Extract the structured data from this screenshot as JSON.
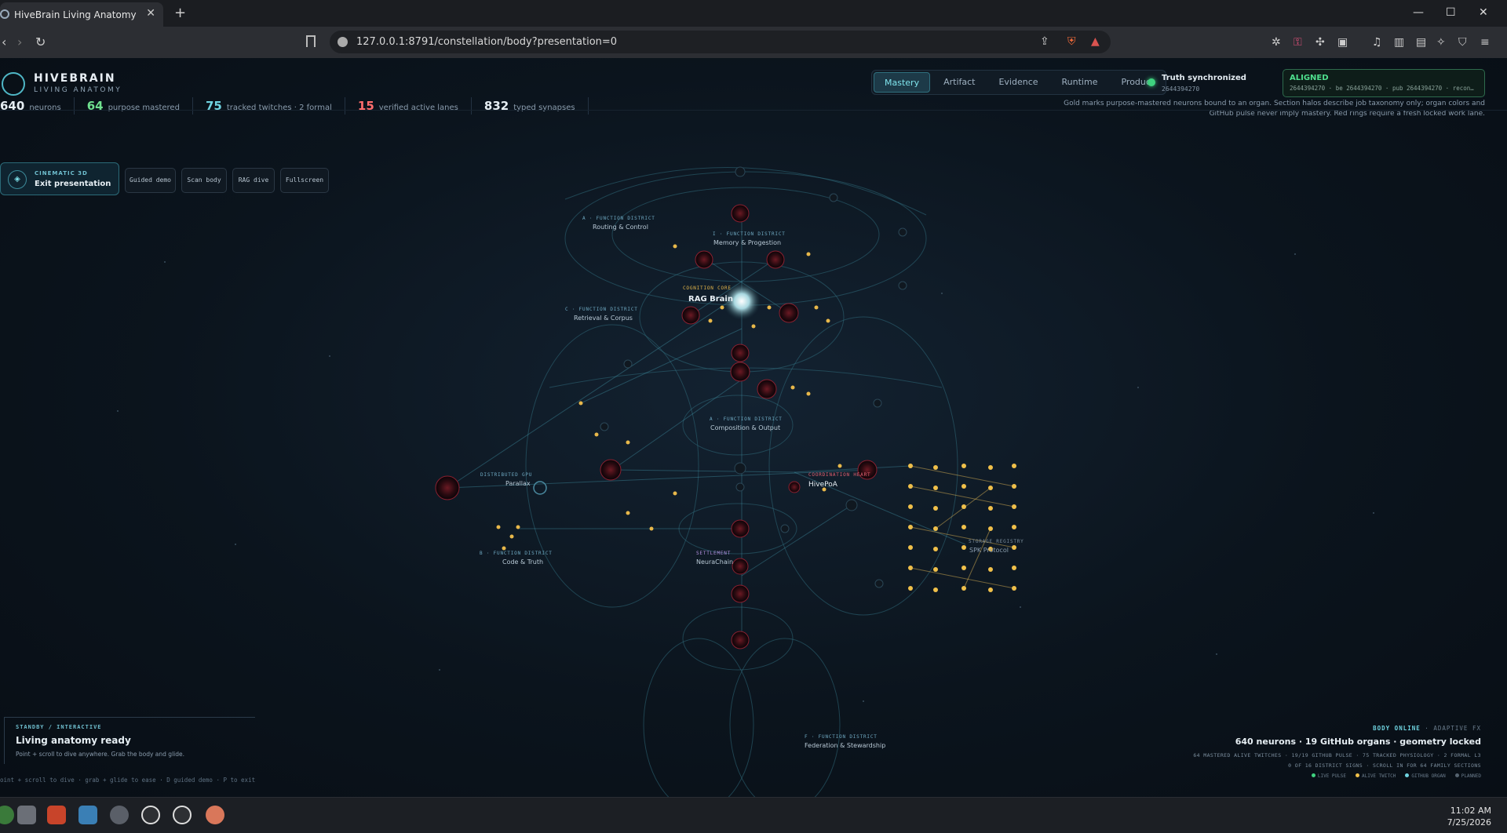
{
  "browser": {
    "tab_title": "HiveBrain Living Anatomy",
    "url": "127.0.0.1:8791/constellation/body?presentation=0"
  },
  "brand": {
    "title": "HIVEBRAIN",
    "subtitle": "LIVING ANATOMY"
  },
  "modes": [
    "Mastery",
    "Artifact",
    "Evidence",
    "Runtime",
    "Product"
  ],
  "truth": {
    "title": "Truth synchronized",
    "hash": "2644394270"
  },
  "aligned": {
    "label": "ALIGNED",
    "detail": "2644394270 · be 2644394270 · pub 2644394270 · recon…"
  },
  "stats": [
    {
      "value": "640",
      "label": "neurons",
      "color": "#e6eef3"
    },
    {
      "value": "64",
      "label": "purpose mastered",
      "color": "#6fe08e"
    },
    {
      "value": "75",
      "label": "tracked twitches · 2 formal",
      "color": "#6fd3e0"
    },
    {
      "value": "15",
      "label": "verified active lanes",
      "color": "#ff6d6d"
    },
    {
      "value": "832",
      "label": "typed synapses",
      "color": "#e6eef3"
    }
  ],
  "note": "Gold marks purpose-mastered neurons bound to an organ. Section halos describe job taxonomy only; organ colors and GitHub pulse never imply mastery. Red rings require a fresh locked work lane.",
  "cinematic": {
    "key": "CINEMATIC 3D",
    "value": "Exit presentation"
  },
  "controls": [
    "Guided demo",
    "Scan body",
    "RAG dive",
    "Fullscreen"
  ],
  "districts": [
    {
      "key": "A · FUNCTION DISTRICT",
      "name": "Routing & Control"
    },
    {
      "key": "I · FUNCTION DISTRICT",
      "name": "Memory & Progestion"
    },
    {
      "key": "COGNITION CORE",
      "name": "RAG Brain"
    },
    {
      "key": "C · FUNCTION DISTRICT",
      "name": "Retrieval & Corpus"
    },
    {
      "key": "A · FUNCTION DISTRICT",
      "name": "Composition & Output"
    },
    {
      "key": "DISTRIBUTED GPU",
      "name": "Parallax"
    },
    {
      "key": "COORDINATION HEART",
      "name": "HivePoA"
    },
    {
      "key": "B · FUNCTION DISTRICT",
      "name": "Code & Truth"
    },
    {
      "key": "SETTLEMENT",
      "name": "NeuraChain"
    },
    {
      "key": "STORAGE REGISTRY",
      "name": "SPK Protocol"
    },
    {
      "key": "F · FUNCTION DISTRICT",
      "name": "Federation & Stewardship"
    }
  ],
  "standby": {
    "key": "STANDBY / INTERACTIVE",
    "title": "Living anatomy ready",
    "sub": "Point + scroll to dive anywhere. Grab the body and glide."
  },
  "hint": "oint + scroll to dive · grab + glide to ease · D guided demo · P to exit",
  "body_online": {
    "key_a": "BODY ONLINE",
    "key_b": " · ADAPTIVE FX",
    "title": "640 neurons · 19 GitHub organs · geometry locked",
    "meta1": "64 MASTERED ALIVE TWITCHES · 19/19 GITHUB PULSE · 75 TRACKED PHYSIOLOGY · 2 FORMAL L3",
    "meta2": "0 OF 16 DISTRICT SIGNS · SCROLL IN FOR 64 FAMILY SECTIONS",
    "legend": [
      "LIVE PULSE",
      "ALIVE TWITCH",
      "GITHUB ORGAN",
      "PLANNED"
    ]
  },
  "clock": {
    "time": "11:02 AM",
    "date": "7/25/2026"
  },
  "colors": {
    "accent": "#7fe3ec",
    "gold": "#f0c04a",
    "alert": "#ff6d6d",
    "ok": "#3fd27f"
  }
}
